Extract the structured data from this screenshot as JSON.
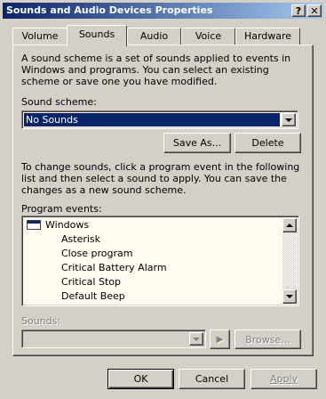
{
  "window": {
    "title": "Sounds and Audio Devices Properties",
    "help_glyph": "?",
    "close_glyph": "✕"
  },
  "tabs": [
    {
      "label": "Volume",
      "active": false
    },
    {
      "label": "Sounds",
      "active": true
    },
    {
      "label": "Audio",
      "active": false
    },
    {
      "label": "Voice",
      "active": false
    },
    {
      "label": "Hardware",
      "active": false
    }
  ],
  "sounds_tab": {
    "description": "A sound scheme is a set of sounds applied to events in Windows and programs.  You can select an existing scheme or save one you have modified.",
    "scheme_label": "Sound scheme:",
    "scheme_value": "No Sounds",
    "save_as_label": "Save As...",
    "delete_label": "Delete",
    "instructions": "To change sounds, click a program event in the following list and then select a sound to apply.  You can save the changes as a new sound scheme.",
    "events_label": "Program events:",
    "events_group": "Windows",
    "events": [
      "Asterisk",
      "Close program",
      "Critical Battery Alarm",
      "Critical Stop",
      "Default Beep"
    ],
    "sounds_label": "Sounds:",
    "sounds_value": "",
    "play_glyph": "▶",
    "browse_label": "Browse..."
  },
  "footer": {
    "ok_label": "OK",
    "cancel_label": "Cancel",
    "apply_label": "Apply"
  },
  "colors": {
    "face": "#d4d0c8",
    "title_active": "#0a246a",
    "selection": "#0a246a",
    "list_background": "#fffbf0"
  }
}
